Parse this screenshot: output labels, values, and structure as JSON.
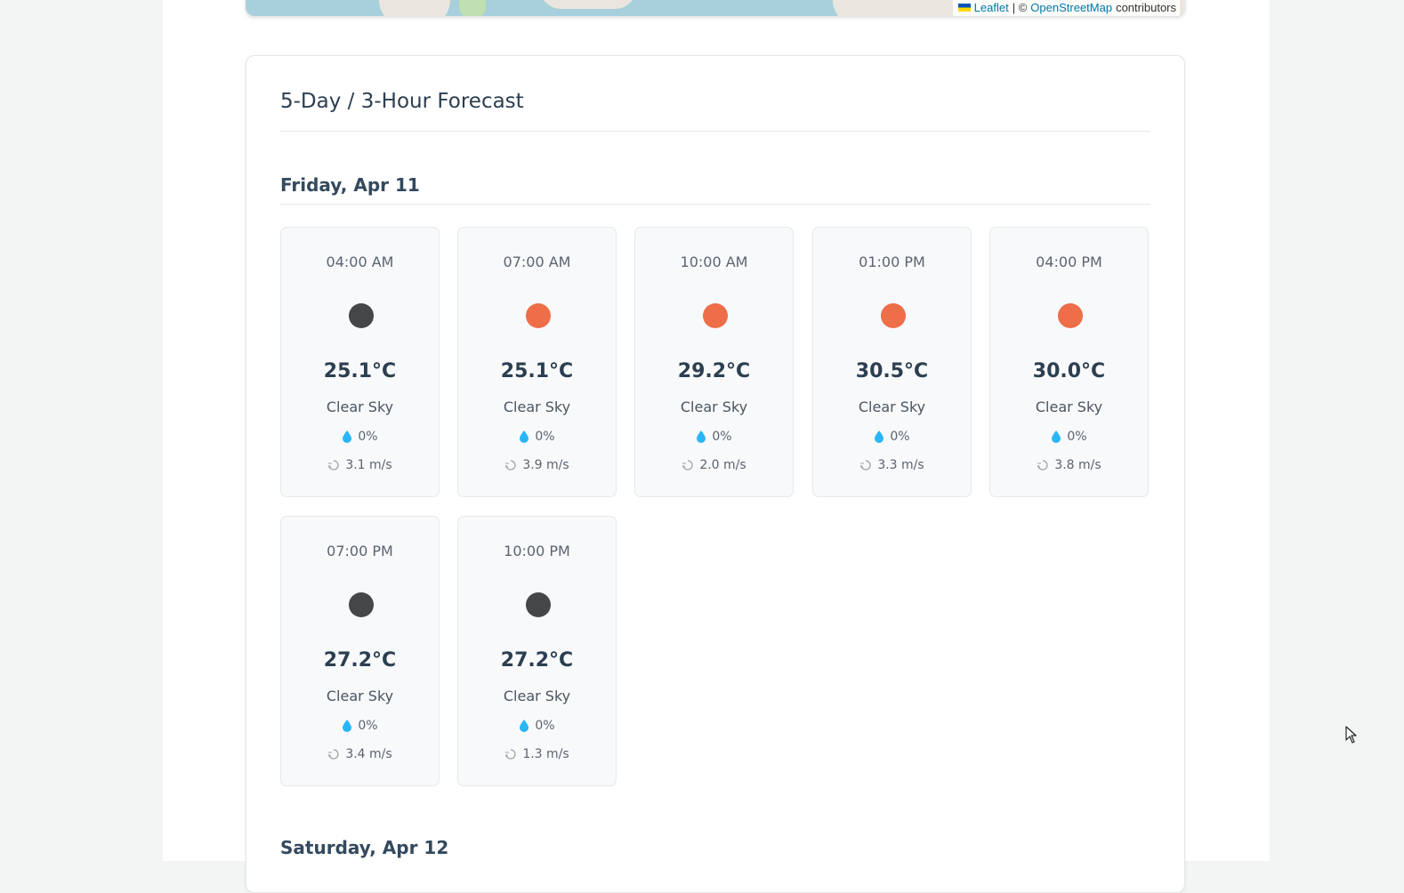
{
  "map": {
    "attribution": {
      "leaflet": "Leaflet",
      "separator": "| ©",
      "osm": "OpenStreetMap",
      "suffix": "contributors"
    }
  },
  "forecast": {
    "title": "5-Day / 3-Hour Forecast",
    "days": [
      {
        "label": "Friday, Apr 11",
        "entries": [
          {
            "time": "04:00 AM",
            "icon": "moon-night-icon",
            "temp": "25.1°C",
            "desc": "Clear Sky",
            "precip": "0%",
            "wind": "3.1 m/s"
          },
          {
            "time": "07:00 AM",
            "icon": "sun-icon",
            "temp": "25.1°C",
            "desc": "Clear Sky",
            "precip": "0%",
            "wind": "3.9 m/s"
          },
          {
            "time": "10:00 AM",
            "icon": "sun-icon",
            "temp": "29.2°C",
            "desc": "Clear Sky",
            "precip": "0%",
            "wind": "2.0 m/s"
          },
          {
            "time": "01:00 PM",
            "icon": "sun-icon",
            "temp": "30.5°C",
            "desc": "Clear Sky",
            "precip": "0%",
            "wind": "3.3 m/s"
          },
          {
            "time": "04:00 PM",
            "icon": "sun-icon",
            "temp": "30.0°C",
            "desc": "Clear Sky",
            "precip": "0%",
            "wind": "3.8 m/s"
          },
          {
            "time": "07:00 PM",
            "icon": "moon-night-icon",
            "temp": "27.2°C",
            "desc": "Clear Sky",
            "precip": "0%",
            "wind": "3.4 m/s"
          },
          {
            "time": "10:00 PM",
            "icon": "moon-night-icon",
            "temp": "27.2°C",
            "desc": "Clear Sky",
            "precip": "0%",
            "wind": "1.3 m/s"
          }
        ]
      },
      {
        "label": "Saturday, Apr 12",
        "entries": []
      }
    ]
  },
  "colors": {
    "sun": "#ee6e4a",
    "night": "#444648",
    "drop": "#29b6f6"
  }
}
